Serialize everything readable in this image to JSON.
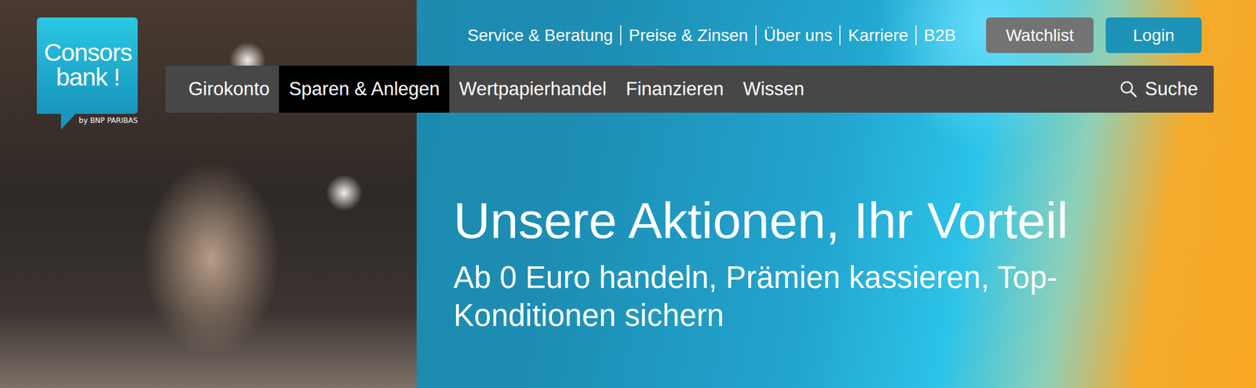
{
  "logo": {
    "line1": "Consors",
    "line2": "bank !",
    "tagline": "by BNP PARIBAS"
  },
  "top_links": [
    "Service & Beratung",
    "Preise & Zinsen",
    "Über uns",
    "Karriere",
    "B2B"
  ],
  "top_buttons": [
    {
      "label": "Watchlist",
      "kind": "secondary"
    },
    {
      "label": "Login",
      "kind": "primary"
    }
  ],
  "nav": {
    "items": [
      {
        "label": "Girokonto",
        "selected": false
      },
      {
        "label": "Sparen & Anlegen",
        "selected": true
      },
      {
        "label": "Wertpapierhandel",
        "selected": false
      },
      {
        "label": "Finanzieren",
        "selected": false
      },
      {
        "label": "Wissen",
        "selected": false
      }
    ],
    "search": "Suche"
  },
  "hero": {
    "title": "Unsere Aktionen, Ihr Vorteil",
    "subtitle": "Ab 0 Euro handeln, Prämien kassieren, Top-Konditionen sichern"
  }
}
